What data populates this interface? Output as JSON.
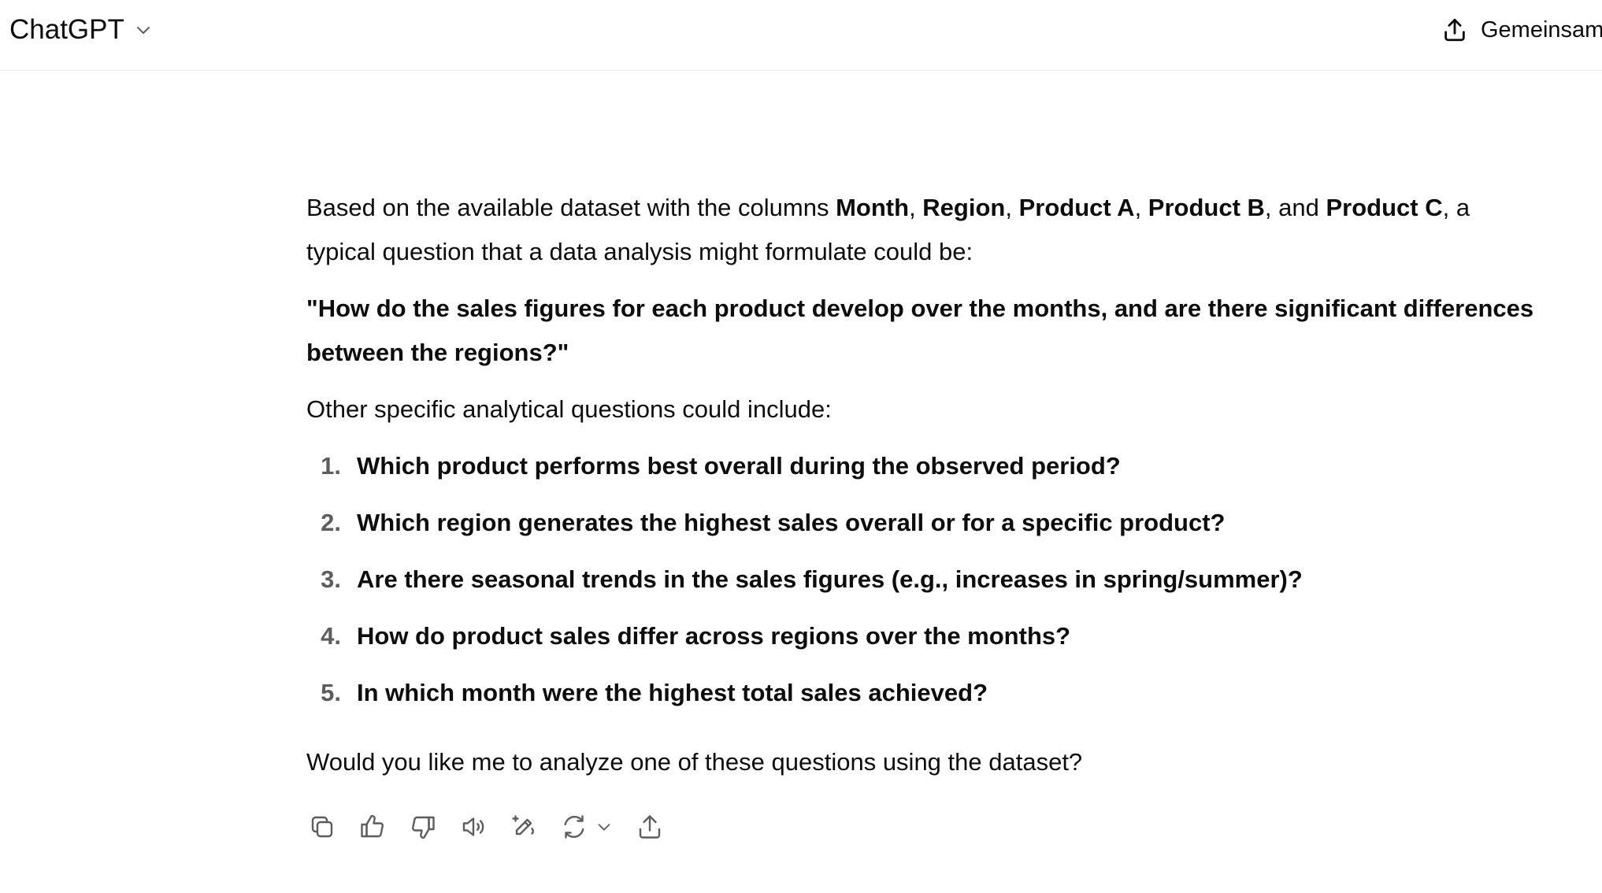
{
  "header": {
    "model_name": "ChatGPT",
    "share_label": "Gemeinsam"
  },
  "message": {
    "intro": {
      "t1": "Based on the available dataset with the columns ",
      "b1": "Month",
      "t2": ", ",
      "b2": "Region",
      "t3": ", ",
      "b3": "Product A",
      "t4": ", ",
      "b4": "Product B",
      "t5": ", and ",
      "b5": "Product C",
      "t6": ", a typical question that a data analysis might formulate could be:"
    },
    "quote": "\"How do the sales figures for each product develop over the months, and are there significant differences between the regions?\"",
    "other_intro": "Other specific analytical questions could include:",
    "questions": [
      {
        "num": "1.",
        "text": "Which product performs best overall during the observed period?"
      },
      {
        "num": "2.",
        "text": "Which region generates the highest sales overall or for a specific product?"
      },
      {
        "num": "3.",
        "text": "Are there seasonal trends in the sales figures (e.g., increases in spring/summer)?"
      },
      {
        "num": "4.",
        "text": "How do product sales differ across regions over the months?"
      },
      {
        "num": "5.",
        "text": "In which month were the highest total sales achieved?"
      }
    ],
    "closing": "Would you like me to analyze one of these questions using the dataset?"
  },
  "actions": [
    "copy-icon",
    "thumbs-up-icon",
    "thumbs-down-icon",
    "read-aloud-icon",
    "edit-icon",
    "regenerate-icon",
    "share-icon"
  ],
  "colors": {
    "text": "#0d0d0d",
    "muted": "#5d5d5d",
    "divider": "#ececec",
    "background": "#ffffff"
  }
}
